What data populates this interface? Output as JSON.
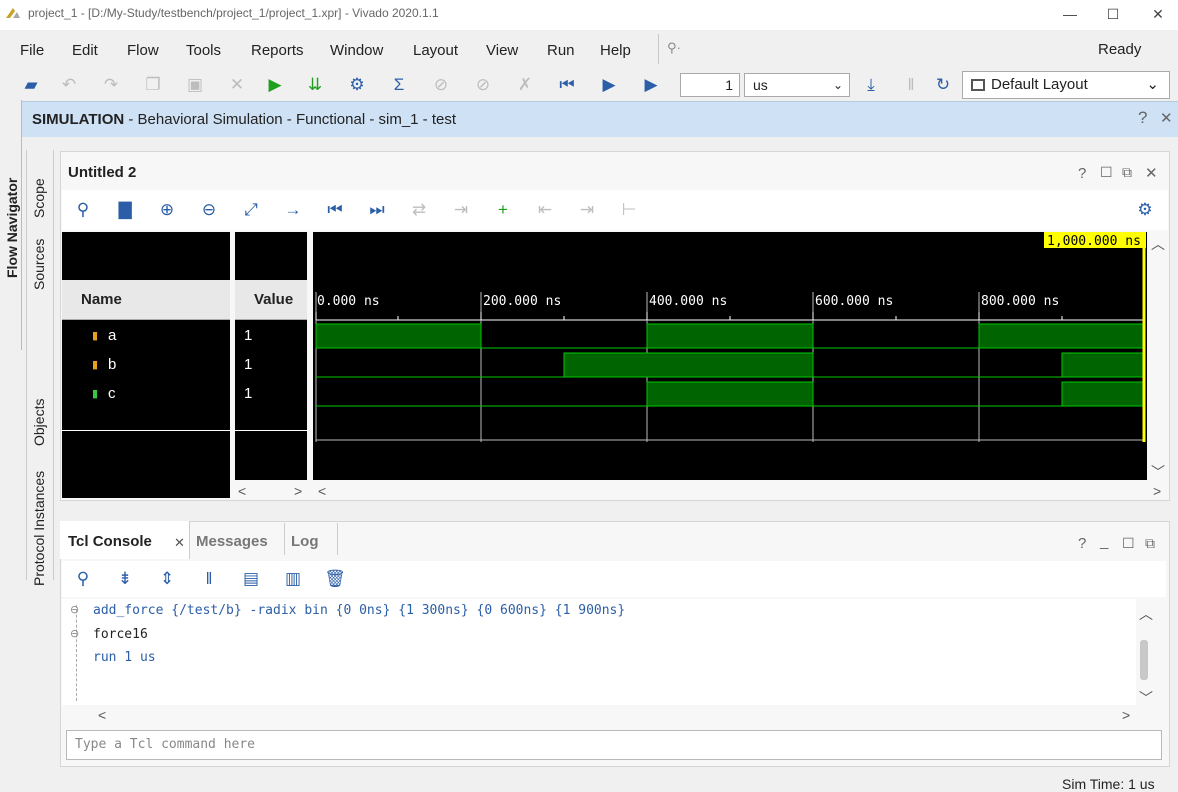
{
  "window": {
    "title": "project_1 - [D:/My-Study/testbench/project_1/project_1.xpr] - Vivado 2020.1.1",
    "minimize": "—",
    "maximize": "☐",
    "close": "✕"
  },
  "menu": {
    "items": [
      "File",
      "Edit",
      "Flow",
      "Tools",
      "Reports",
      "Window",
      "Layout",
      "View",
      "Run",
      "Help"
    ],
    "search_glyph": "⚲·",
    "status": "Ready"
  },
  "toolbar": {
    "run_value": "1",
    "run_unit": "us",
    "layout": "Default Layout"
  },
  "simulation": {
    "label": "SIMULATION",
    "detail": " - Behavioral Simulation - Functional - sim_1 - test"
  },
  "side_tabs": [
    "Flow Navigator",
    "Scope",
    "Sources",
    "Objects",
    "Protocol Instances"
  ],
  "wave": {
    "title": "Untitled 2",
    "name_header": "Name",
    "value_header": "Value",
    "cursor_label": "1,000.000 ns",
    "time_labels": [
      "0.000 ns",
      "200.000 ns",
      "400.000 ns",
      "600.000 ns",
      "800.000 ns"
    ],
    "signals": [
      {
        "name": "a",
        "value": "1"
      },
      {
        "name": "b",
        "value": "1"
      },
      {
        "name": "c",
        "value": "1"
      }
    ],
    "colors": {
      "wave": "#00c800",
      "fill": "#006400",
      "cursor": "#ffff00",
      "bg": "#000000"
    }
  },
  "console": {
    "tabs": [
      "Tcl Console",
      "Messages",
      "Log"
    ],
    "lines": [
      "add_force {/test/b} -radix bin {0 0ns} {1 300ns} {0 600ns} {1 900ns}",
      "force16",
      "run 1 us"
    ],
    "placeholder": "Type a Tcl command here"
  },
  "status": {
    "sim_time": "Sim Time: 1 us"
  }
}
